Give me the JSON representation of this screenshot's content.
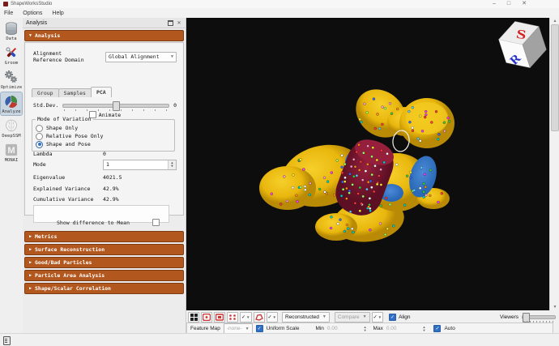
{
  "window": {
    "title": "ShapeWorksStudio",
    "menus": [
      "File",
      "Options",
      "Help"
    ]
  },
  "rail": {
    "items": [
      {
        "id": "data",
        "label": "Data",
        "selected": false
      },
      {
        "id": "groom",
        "label": "Groom",
        "selected": false
      },
      {
        "id": "optimize",
        "label": "Optimize",
        "selected": false
      },
      {
        "id": "analyze",
        "label": "Analyze",
        "selected": true
      },
      {
        "id": "deepssm",
        "label": "DeepSSM",
        "selected": false
      },
      {
        "id": "monai",
        "label": "MONAI",
        "selected": false
      }
    ]
  },
  "dock": {
    "title": "Analysis"
  },
  "analysis": {
    "header": "Analysis",
    "alignment_label": "Alignment\nReference Domain",
    "alignment_value": "Global Alignment",
    "tabs": [
      {
        "label": "Group",
        "active": false
      },
      {
        "label": "Samples",
        "active": false
      },
      {
        "label": "PCA",
        "active": true
      }
    ],
    "stddev": {
      "label": "Std.Dev.",
      "value": "0"
    },
    "animate_label": "Animate",
    "variation": {
      "legend": "Mode of Variation",
      "options": [
        {
          "label": "Shape Only",
          "selected": false
        },
        {
          "label": "Relative Pose Only",
          "selected": false
        },
        {
          "label": "Shape and Pose",
          "selected": true
        }
      ]
    },
    "lambda": {
      "label": "Lambda",
      "value": "0"
    },
    "mode": {
      "label": "Mode",
      "value": "1"
    },
    "eigenvalue": {
      "label": "Eigenvalue",
      "value": "4021.5"
    },
    "explained": {
      "label": "Explained Variance",
      "value": "42.9%"
    },
    "cumulative": {
      "label": "Cumulative Variance",
      "value": "42.9%"
    },
    "show_diff_label": "Show difference to Mean"
  },
  "sections": [
    "Metrics",
    "Surface Reconstruction",
    "Good/Bad Particles",
    "Particle Area Analysis",
    "Shape/Scalar Correlation"
  ],
  "viewer": {
    "cube": {
      "top_letter": "S",
      "front_letter": "R",
      "top_letter_color": "#d42020",
      "front_letter_color": "#2433c8"
    }
  },
  "controls": {
    "reconstructed": "Reconstructed",
    "compare": "Compare",
    "align_label": "Align",
    "viewers_label": "Viewers",
    "feature_map_label": "Feature Map",
    "feature_map_value": "-none-",
    "uniform_scale_label": "Uniform Scale",
    "min_label": "Min",
    "min_value": "0.00",
    "max_label": "Max",
    "max_value": "0.00",
    "auto_label": "Auto"
  },
  "colors": {
    "accent": "#b2571e",
    "viewer_bg": "#0d0d0d",
    "shape_yellow": "#e9b70e",
    "shape_yellow_dark": "#b88a05",
    "shape_maroon": "#7c1a33",
    "shape_maroon_light": "#96203c",
    "shape_blue": "#2a6ab8",
    "check_blue": "#2f6fc4",
    "particle_palette": [
      "#ffffff",
      "#ff3b3b",
      "#3ecf3e",
      "#3b6cff",
      "#00d0d0",
      "#ff3bff",
      "#ffee33",
      "#ff8d1a",
      "#a0ff66",
      "#ff9ccd",
      "#66ccff"
    ]
  }
}
